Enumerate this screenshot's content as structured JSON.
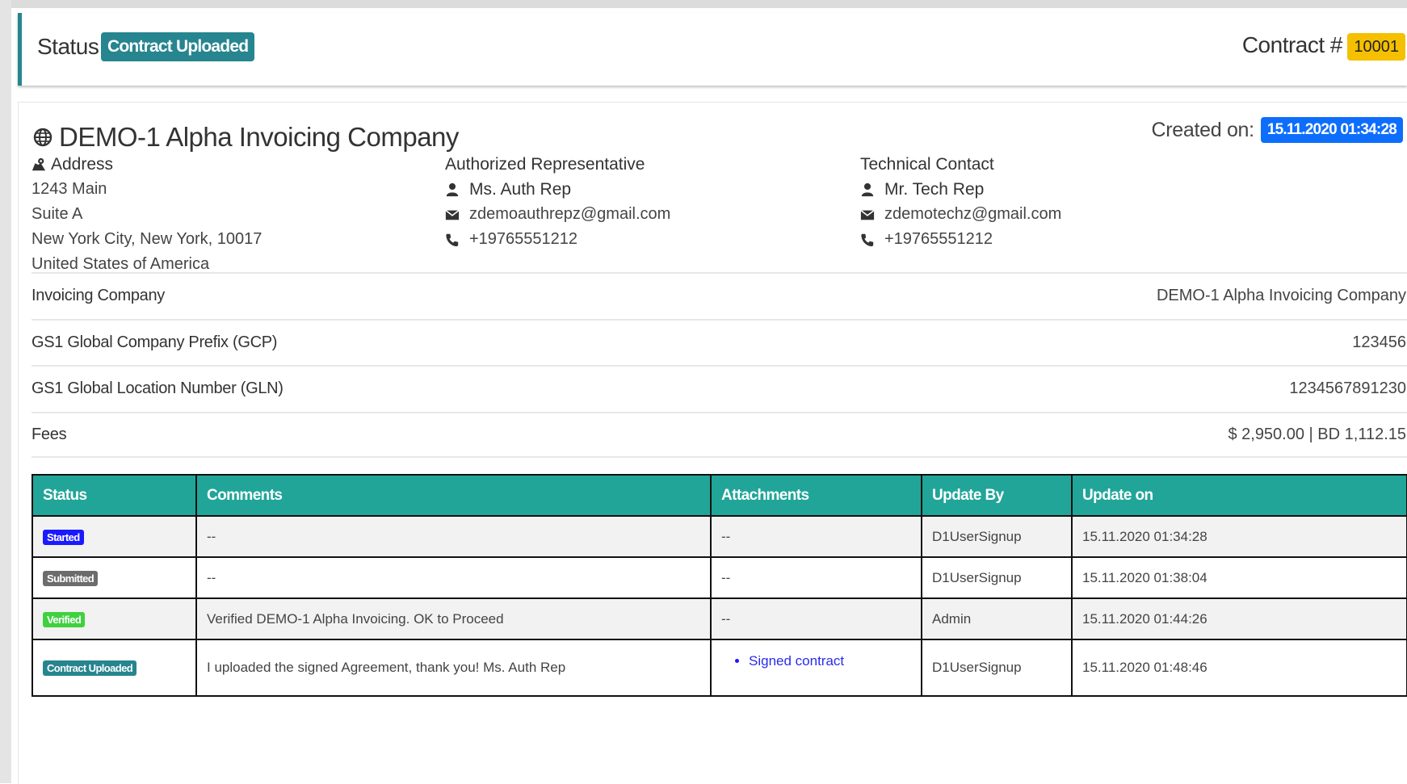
{
  "header": {
    "status_label": "Status:",
    "status_value": "Contract Uploaded",
    "contract_label": "Contract #",
    "contract_number": "10001"
  },
  "company": {
    "name": "DEMO-1 Alpha Invoicing Company",
    "created_label": "Created on:",
    "created_value": "15.11.2020 01:34:28"
  },
  "address": {
    "heading": "Address",
    "lines": [
      "1243 Main",
      "Suite A",
      "New York City, New York, 10017",
      "United States of America"
    ]
  },
  "authorized_rep": {
    "heading": "Authorized Representative",
    "name": "Ms. Auth Rep",
    "email": "zdemoauthrepz@gmail.com",
    "phone": "+19765551212"
  },
  "technical_contact": {
    "heading": "Technical Contact",
    "name": "Mr. Tech Rep",
    "email": "zdemotechz@gmail.com",
    "phone": "+19765551212"
  },
  "details": [
    {
      "label": "Invoicing Company",
      "value": "DEMO-1 Alpha Invoicing Company"
    },
    {
      "label": "GS1 Global Company Prefix (GCP)",
      "value": "123456"
    },
    {
      "label": "GS1 Global Location Number (GLN)",
      "value": "1234567891230"
    },
    {
      "label": "Fees",
      "value": "$ 2,950.00 | BD 1,112.15"
    }
  ],
  "history": {
    "columns": [
      "Status",
      "Comments",
      "Attachments",
      "Update By",
      "Update on"
    ],
    "rows": [
      {
        "status": "Started",
        "status_color": "#1a1aff",
        "comments": "--",
        "attachments": "--",
        "update_by": "D1UserSignup",
        "update_on": "15.11.2020 01:34:28"
      },
      {
        "status": "Submitted",
        "status_color": "#6c6c6c",
        "comments": "--",
        "attachments": "--",
        "update_by": "D1UserSignup",
        "update_on": "15.11.2020 01:38:04"
      },
      {
        "status": "Verified",
        "status_color": "#3fd13f",
        "comments": "Verified DEMO-1 Alpha Invoicing. OK to Proceed",
        "attachments": "--",
        "update_by": "Admin",
        "update_on": "15.11.2020 01:44:26"
      },
      {
        "status": "Contract Uploaded",
        "status_color": "#26858f",
        "comments": "I uploaded the signed Agreement, thank you! Ms. Auth Rep",
        "attachment_link": "Signed contract",
        "update_by": "D1UserSignup",
        "update_on": "15.11.2020 01:48:46"
      }
    ]
  },
  "colors": {
    "accent_teal": "#26858f",
    "table_header": "#21a599",
    "contract_badge": "#f5c000",
    "date_badge": "#0d6efd"
  },
  "icons": [
    "globe-icon",
    "map-icon",
    "user-icon",
    "envelope-icon",
    "phone-icon"
  ]
}
